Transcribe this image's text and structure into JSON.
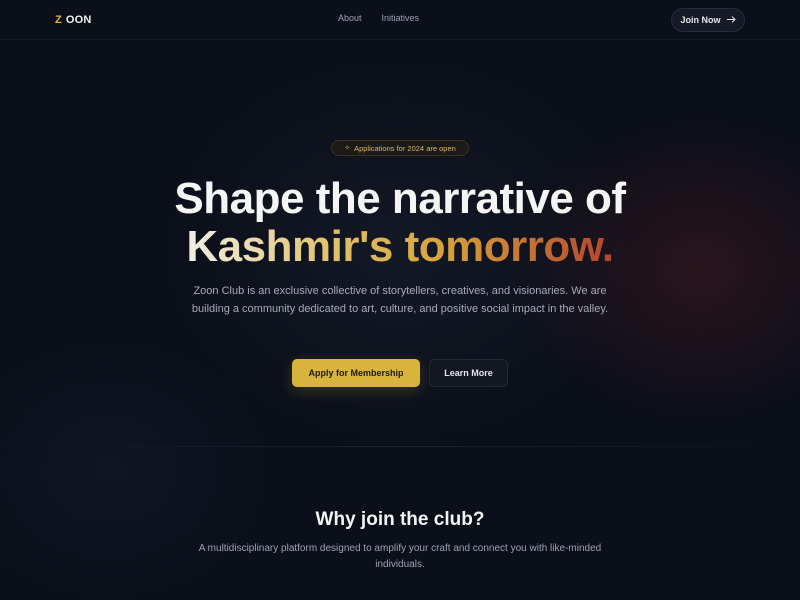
{
  "header": {
    "logo_mark": "Z",
    "logo_text": "OON",
    "nav": [
      "About",
      "Initiatives"
    ],
    "join_label": "Join Now",
    "join_icon": "arrow-right-icon"
  },
  "hero": {
    "badge_icon": "sparkle-icon",
    "badge_text": "Applications for 2024 are open",
    "title_line1": "Shape the narrative of",
    "title_line2": "Kashmir's tomorrow.",
    "description": "Zoon Club is an exclusive collective of storytellers, creatives, and visionaries. We are building a community dedicated to art, culture, and positive social impact in the valley.",
    "primary_cta": "Apply for Membership",
    "secondary_cta": "Learn More"
  },
  "why": {
    "title": "Why join the club?",
    "description": "A multidisciplinary platform designed to amplify your craft and connect you with like-minded individuals."
  },
  "colors": {
    "background": "#0b0f19",
    "accent": "#d8b43c",
    "gradient_end": "#b2452f"
  }
}
